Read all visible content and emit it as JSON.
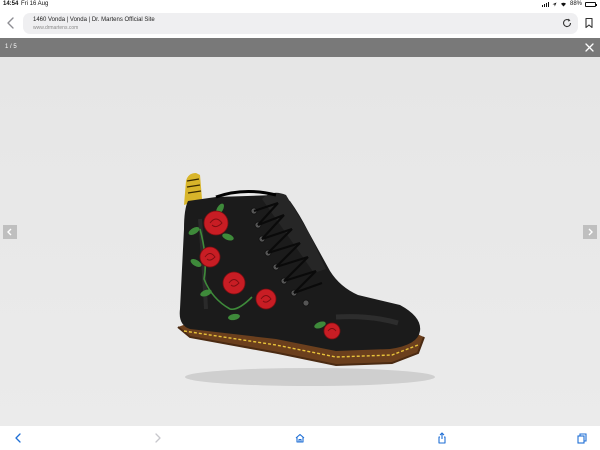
{
  "status_bar": {
    "time": "14:54",
    "date": "Fri 16 Aug",
    "battery": "88%",
    "battery_level": 0.88
  },
  "browser": {
    "page_title": "1460 Vonda | Vonda | Dr. Martens Official Site",
    "domain": "www.drmartens.com"
  },
  "gallery": {
    "counter": "1 / 5",
    "image_subject": "Black leather 8-eye boot with embroidered red roses"
  },
  "colors": {
    "header_bar": "#797979",
    "gallery_background": "#e9e9e9",
    "nav_arrow": "#bfbfbf",
    "toolbar_icons": "#1f6fd6",
    "toolbar_disabled": "#c7c7cc",
    "boot_leather": "#1b1b1b",
    "sole": "#6b3f1d",
    "welt_stitch": "#e8c33a",
    "rose": "#c81d24",
    "leaf": "#3e8a3a"
  },
  "icons": {
    "back": "chevron-left-icon",
    "reload": "reload-icon",
    "bookmark": "bookmark-icon",
    "close": "close-icon",
    "prev": "chevron-left-icon",
    "next": "chevron-right-icon",
    "home": "home-icon",
    "share": "share-icon",
    "tabs": "tabs-icon"
  }
}
